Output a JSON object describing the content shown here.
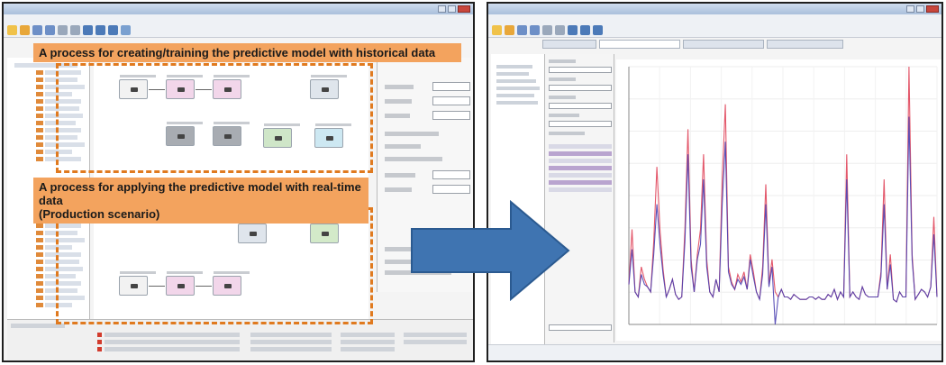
{
  "left": {
    "banner_training": "A process for creating/training the predictive model with historical data",
    "banner_production_line1": "A process for applying the predictive model with real-time data",
    "banner_production_line2": "(Production scenario)"
  },
  "colors": {
    "banner_fill": "#f3a35e",
    "dashed_border": "#e07a1f",
    "arrow_fill": "#3f74b1",
    "series_red": "#e0455a",
    "series_blue": "#4a3fb0"
  },
  "icons": [
    "right-arrow-icon"
  ],
  "chart_data": {
    "type": "line",
    "title": "",
    "xlabel": "",
    "ylabel": "",
    "grid": true,
    "series": [
      {
        "color": "#e0455a",
        "values": [
          8,
          30,
          5,
          3,
          15,
          10,
          7,
          5,
          25,
          55,
          30,
          14,
          3,
          6,
          10,
          4,
          2,
          3,
          30,
          70,
          18,
          5,
          20,
          30,
          60,
          18,
          5,
          3,
          10,
          5,
          50,
          80,
          15,
          9,
          6,
          12,
          9,
          13,
          6,
          20,
          13,
          5,
          2,
          15,
          48,
          8,
          18,
          5,
          3,
          6,
          3,
          3,
          2,
          4,
          3,
          2,
          2,
          2,
          3,
          3,
          2,
          3,
          2,
          2,
          4,
          3,
          6,
          2,
          5,
          3,
          60,
          3,
          5,
          3,
          2,
          7,
          4,
          3,
          3,
          3,
          3,
          13,
          50,
          6,
          20,
          2,
          1,
          5,
          3,
          3,
          95,
          20,
          2,
          4,
          6,
          5,
          3,
          7,
          35,
          3
        ]
      },
      {
        "color": "#4a3fb0",
        "values": [
          8,
          22,
          5,
          3,
          12,
          8,
          7,
          5,
          20,
          40,
          24,
          12,
          3,
          6,
          10,
          4,
          2,
          3,
          25,
          60,
          15,
          5,
          18,
          24,
          50,
          15,
          5,
          3,
          10,
          5,
          40,
          65,
          13,
          8,
          6,
          10,
          8,
          11,
          6,
          18,
          11,
          5,
          2,
          12,
          40,
          7,
          15,
          -8,
          3,
          6,
          3,
          3,
          2,
          4,
          3,
          2,
          2,
          2,
          3,
          3,
          2,
          3,
          2,
          2,
          4,
          3,
          6,
          2,
          5,
          3,
          50,
          3,
          5,
          3,
          2,
          7,
          4,
          3,
          3,
          3,
          3,
          11,
          40,
          6,
          16,
          2,
          1,
          5,
          3,
          3,
          75,
          18,
          2,
          4,
          6,
          5,
          3,
          7,
          28,
          3
        ]
      }
    ]
  }
}
